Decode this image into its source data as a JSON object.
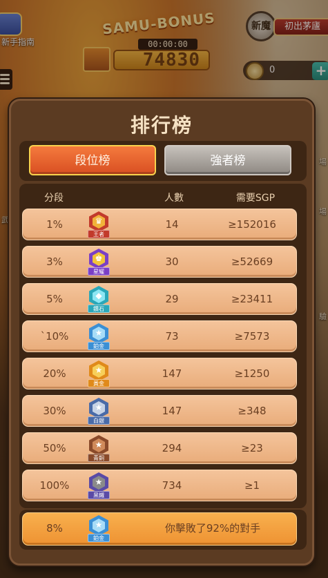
{
  "hud": {
    "guide_label": "新手指南",
    "bonus_title": "SAMU-BONUS",
    "bonus_timer": "00:00:00",
    "bonus_amount": "74830",
    "rank_badge": "新魔",
    "rank_title": "初出茅廬",
    "coins": "0",
    "plus": "+",
    "side_snips": [
      "場",
      "場",
      "武",
      "驗"
    ]
  },
  "panel": {
    "title": "排行榜",
    "tabs": [
      {
        "label": "段位榜",
        "active": true
      },
      {
        "label": "強者榜",
        "active": false
      }
    ],
    "headers": {
      "tier": "分段",
      "count": "人數",
      "sgp": "需要SGP"
    },
    "rows": [
      {
        "tier": "1%",
        "badge": "王者",
        "count": "14",
        "sgp": "≥152016",
        "color": "#c23a2b",
        "inner": "#f1b23a",
        "icon": "trophy-icon"
      },
      {
        "tier": "3%",
        "badge": "星耀",
        "count": "30",
        "sgp": "≥52669",
        "color": "#7a3fc6",
        "inner": "#f1c33a",
        "icon": "crown-icon"
      },
      {
        "tier": "5%",
        "badge": "鑽石",
        "count": "29",
        "sgp": "≥23411",
        "color": "#2aa7b8",
        "inner": "#8de6f3",
        "icon": "diamond-icon"
      },
      {
        "tier": "`10%",
        "badge": "鉑金",
        "count": "73",
        "sgp": "≥7573",
        "color": "#3b8fd4",
        "inner": "#a7dcf7",
        "icon": "star-icon"
      },
      {
        "tier": "20%",
        "badge": "黃金",
        "count": "147",
        "sgp": "≥1250",
        "color": "#e08a1a",
        "inner": "#f7cf5a",
        "icon": "star-icon"
      },
      {
        "tier": "30%",
        "badge": "白銀",
        "count": "147",
        "sgp": "≥348",
        "color": "#4a6ba8",
        "inner": "#c7d3e6",
        "icon": "star-icon"
      },
      {
        "tier": "50%",
        "badge": "青銅",
        "count": "294",
        "sgp": "≥23",
        "color": "#8a4a2a",
        "inner": "#d08a5a",
        "icon": "star-icon"
      },
      {
        "tier": "100%",
        "badge": "黑鐵",
        "count": "734",
        "sgp": "≥1",
        "color": "#5a4aa6",
        "inner": "#8a8a8a",
        "icon": "star-icon"
      }
    ],
    "summary": {
      "tier": "8%",
      "badge": "鉑金",
      "message": "你擊敗了92%的對手",
      "color": "#3b8fd4",
      "inner": "#a7dcf7",
      "icon": "star-icon"
    }
  }
}
